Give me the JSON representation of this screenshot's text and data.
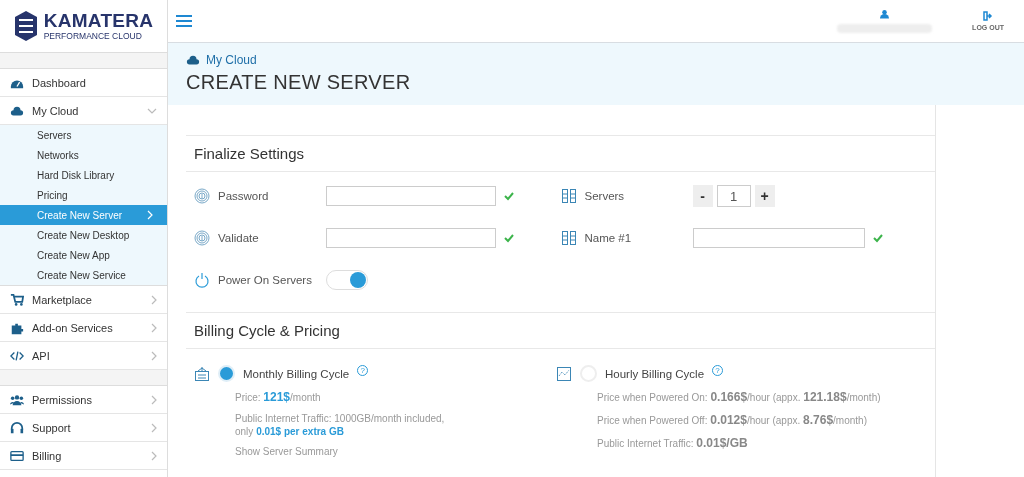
{
  "brand": {
    "name": "KAMATERA",
    "tagline": "PERFORMANCE CLOUD"
  },
  "sidebar": {
    "groups": [
      [
        {
          "label": "Dashboard",
          "kind": "link"
        },
        {
          "label": "My Cloud",
          "kind": "submenu",
          "expanded": true,
          "children": [
            {
              "label": "Servers",
              "selected": false
            },
            {
              "label": "Networks",
              "selected": false
            },
            {
              "label": "Hard Disk Library",
              "selected": false
            },
            {
              "label": "Pricing",
              "selected": false
            },
            {
              "label": "Create New Server",
              "selected": true
            },
            {
              "label": "Create New Desktop",
              "selected": false
            },
            {
              "label": "Create New App",
              "selected": false
            },
            {
              "label": "Create New Service",
              "selected": false
            }
          ]
        },
        {
          "label": "Marketplace",
          "kind": "submenu",
          "expanded": false
        },
        {
          "label": "Add-on Services",
          "kind": "submenu",
          "expanded": false
        },
        {
          "label": "API",
          "kind": "submenu",
          "expanded": false
        }
      ],
      [
        {
          "label": "Permissions",
          "kind": "submenu",
          "expanded": false
        },
        {
          "label": "Support",
          "kind": "submenu",
          "expanded": false
        },
        {
          "label": "Billing",
          "kind": "submenu",
          "expanded": false
        }
      ]
    ]
  },
  "topbar": {
    "logout": "LOG OUT"
  },
  "header": {
    "breadcrumb": "My Cloud",
    "title": "CREATE NEW SERVER"
  },
  "finalize": {
    "title": "Finalize Settings",
    "left": [
      {
        "kind": "input",
        "label": "Password",
        "valid": true
      },
      {
        "kind": "input",
        "label": "Validate",
        "valid": true
      },
      {
        "kind": "toggle",
        "label": "Power On Servers",
        "on": true
      }
    ],
    "right": [
      {
        "kind": "stepper",
        "label": "Servers",
        "minus": "-",
        "value": "1",
        "plus": "+"
      },
      {
        "kind": "input",
        "label": "Name #1",
        "valid": true
      }
    ]
  },
  "billing": {
    "title": "Billing Cycle & Pricing",
    "options": [
      {
        "label": "Monthly Billing Cycle",
        "selected": true,
        "help": "?",
        "lines": [
          "Price: **121$**/month",
          "Public Internet Traffic: 1000GB/month included, only **0.01$ per extra GB**",
          "Show Server Summary"
        ]
      },
      {
        "label": "Hourly Billing Cycle",
        "selected": false,
        "help": "?",
        "lines": [
          "Price when Powered On: **0.166$**/hour (appx. **121.18$**/month)",
          "Price when Powered Off: **0.012$**/hour (appx. **8.76$**/month)",
          "Public Internet Traffic: **0.01$/GB**"
        ]
      }
    ]
  }
}
